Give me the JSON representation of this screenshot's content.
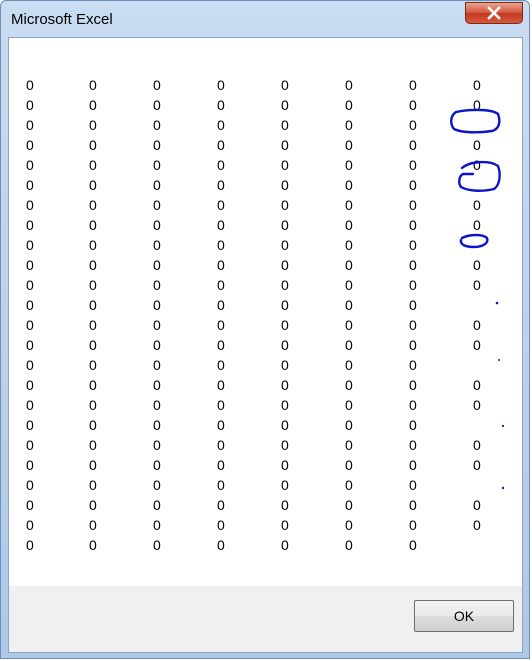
{
  "window": {
    "title": "Microsoft Excel",
    "close_icon": "close-icon"
  },
  "message": {
    "columns": 8,
    "rows": [
      [
        "0",
        "0",
        "0",
        "0",
        "0",
        "0",
        "0",
        "0"
      ],
      [
        "0",
        "0",
        "0",
        "0",
        "0",
        "0",
        "0",
        "0"
      ],
      [
        "0",
        "0",
        "0",
        "0",
        "0",
        "0",
        "0",
        ""
      ],
      [
        "0",
        "0",
        "0",
        "0",
        "0",
        "0",
        "0",
        "0"
      ],
      [
        "0",
        "0",
        "0",
        "0",
        "0",
        "0",
        "0",
        "0"
      ],
      [
        "0",
        "0",
        "0",
        "0",
        "0",
        "0",
        "0",
        ""
      ],
      [
        "0",
        "0",
        "0",
        "0",
        "0",
        "0",
        "0",
        "0"
      ],
      [
        "0",
        "0",
        "0",
        "0",
        "0",
        "0",
        "0",
        "0"
      ],
      [
        "0",
        "0",
        "0",
        "0",
        "0",
        "0",
        "0",
        ""
      ],
      [
        "0",
        "0",
        "0",
        "0",
        "0",
        "0",
        "0",
        "0"
      ],
      [
        "0",
        "0",
        "0",
        "0",
        "0",
        "0",
        "0",
        "0"
      ],
      [
        "0",
        "0",
        "0",
        "0",
        "0",
        "0",
        "0",
        ""
      ],
      [
        "0",
        "0",
        "0",
        "0",
        "0",
        "0",
        "0",
        "0"
      ],
      [
        "0",
        "0",
        "0",
        "0",
        "0",
        "0",
        "0",
        "0"
      ],
      [
        "0",
        "0",
        "0",
        "0",
        "0",
        "0",
        "0",
        ""
      ],
      [
        "0",
        "0",
        "0",
        "0",
        "0",
        "0",
        "0",
        "0"
      ],
      [
        "0",
        "0",
        "0",
        "0",
        "0",
        "0",
        "0",
        "0"
      ],
      [
        "0",
        "0",
        "0",
        "0",
        "0",
        "0",
        "0",
        ""
      ],
      [
        "0",
        "0",
        "0",
        "0",
        "0",
        "0",
        "0",
        "0"
      ],
      [
        "0",
        "0",
        "0",
        "0",
        "0",
        "0",
        "0",
        "0"
      ],
      [
        "0",
        "0",
        "0",
        "0",
        "0",
        "0",
        "0",
        ""
      ],
      [
        "0",
        "0",
        "0",
        "0",
        "0",
        "0",
        "0",
        "0"
      ],
      [
        "0",
        "0",
        "0",
        "0",
        "0",
        "0",
        "0",
        "0"
      ],
      [
        "0",
        "0",
        "0",
        "0",
        "0",
        "0",
        "0",
        ""
      ]
    ]
  },
  "buttons": {
    "ok_label": "OK"
  },
  "annotation_color": "#0a14c8"
}
